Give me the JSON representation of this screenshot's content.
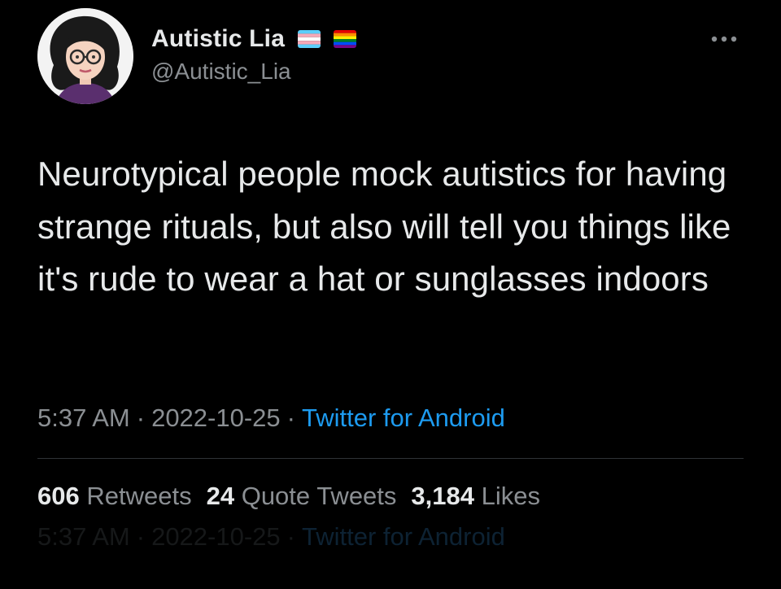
{
  "author": {
    "display_name": "Autistic Lia",
    "handle": "@Autistic_Lia",
    "flags": [
      "transgender-flag-icon",
      "rainbow-flag-icon"
    ]
  },
  "tweet": {
    "text": "Neurotypical people mock autistics for having strange rituals, but also will tell you things like it's rude to wear a hat or sunglasses indoors",
    "time": "5:37 AM",
    "date": "2022-10-25",
    "separator": "·",
    "source": "Twitter for Android"
  },
  "stats": {
    "retweets_count": "606",
    "retweets_label": "Retweets",
    "quotes_count": "24",
    "quotes_label": "Quote Tweets",
    "likes_count": "3,184",
    "likes_label": "Likes"
  },
  "colors": {
    "background": "#000000",
    "primary_text": "#e7e9ea",
    "secondary_text": "#8b8f93",
    "link": "#1d9bf0",
    "divider": "#2f3336"
  },
  "icons": {
    "more": "more-options-icon"
  }
}
